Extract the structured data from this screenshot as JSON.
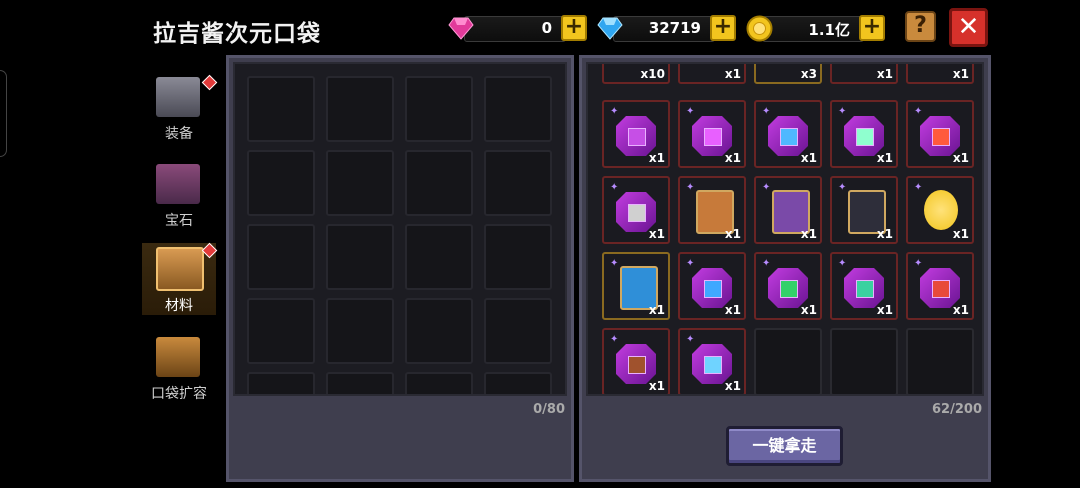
{
  "title": "拉吉酱次元口袋",
  "currencies": {
    "gem": {
      "value": "0",
      "icon": "pink-gem-icon"
    },
    "diamond": {
      "value": "32719",
      "icon": "blue-diamond-icon"
    },
    "coin": {
      "value": "1.1亿",
      "icon": "gold-coin-icon"
    }
  },
  "buttons": {
    "plus": "+",
    "help": "?",
    "close": "✕",
    "take_all": "一键拿走"
  },
  "tabs": [
    {
      "label": "装备"
    },
    {
      "label": "宝石"
    },
    {
      "label": "材料"
    },
    {
      "label": "口袋扩容"
    }
  ],
  "left_panel": {
    "count": "0/80"
  },
  "right_panel": {
    "count": "62/200",
    "top_row_qty": [
      "x10",
      "x1",
      "x3",
      "x1",
      "x1"
    ],
    "items": [
      {
        "kind": "gem",
        "qty": "x1",
        "core": "#c64fe6"
      },
      {
        "kind": "gem",
        "qty": "x1",
        "core": "#e860ff"
      },
      {
        "kind": "gem",
        "qty": "x1",
        "core": "#4fb8ff"
      },
      {
        "kind": "gem",
        "qty": "x1",
        "core": "#8fffcf"
      },
      {
        "kind": "gem",
        "qty": "x1",
        "core": "#ff5a3c"
      },
      {
        "kind": "gem",
        "qty": "x1",
        "core": "#d0d0d0"
      },
      {
        "kind": "card",
        "qty": "x1",
        "core": "#c77a3a"
      },
      {
        "kind": "card",
        "qty": "x1",
        "core": "#7a4aa8"
      },
      {
        "kind": "card",
        "qty": "x1",
        "core": "#2e2e3a"
      },
      {
        "kind": "coin",
        "qty": "x1",
        "core": "#f2c51e"
      },
      {
        "kind": "card",
        "qty": "x1",
        "core": "#2f8fd8"
      },
      {
        "kind": "gem",
        "qty": "x1",
        "core": "#3fa8ff"
      },
      {
        "kind": "gem",
        "qty": "x1",
        "core": "#33d16a"
      },
      {
        "kind": "gem",
        "qty": "x1",
        "core": "#3ad1a0"
      },
      {
        "kind": "gem",
        "qty": "x1",
        "core": "#e84a3a"
      },
      {
        "kind": "gem",
        "qty": "x1",
        "core": "#a0522d"
      },
      {
        "kind": "gem",
        "qty": "x1",
        "core": "#6fd3ff"
      }
    ]
  }
}
